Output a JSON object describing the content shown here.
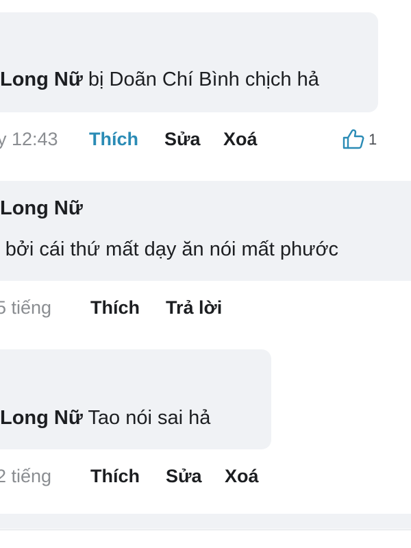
{
  "comments": [
    {
      "author": "Long Nữ",
      "text": "bị Doãn Chí Bình chịch hả",
      "time": "y 12:43",
      "actions": [
        "Thích",
        "Sửa",
        "Xoá"
      ],
      "like_count": "1"
    },
    {
      "author": "Long Nữ",
      "text": "bởi cái thứ mất dạy ăn nói mất phước",
      "time": "5 tiếng",
      "actions": [
        "Thích",
        "Trả lời"
      ]
    },
    {
      "author": "Long Nữ",
      "text": "Tao nói sai hả",
      "time": "2 tiếng",
      "actions": [
        "Thích",
        "Sửa",
        "Xoá"
      ]
    }
  ],
  "colors": {
    "bubble": "#f0f2f5",
    "liked": "#2a8bb5",
    "muted": "#8a8d91"
  }
}
